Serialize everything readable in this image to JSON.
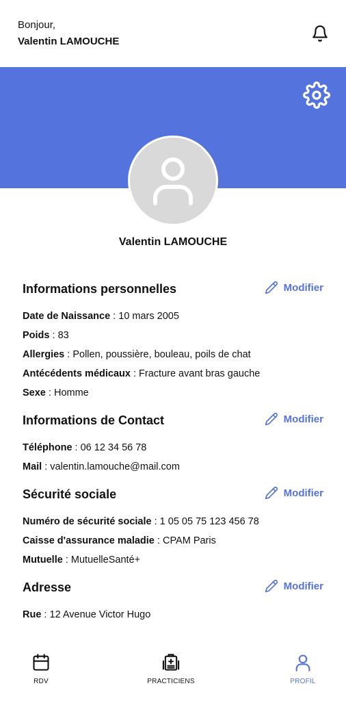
{
  "colors": {
    "accent": "#5573dc",
    "avatar_bg": "#d9d9d9",
    "text": "#111111"
  },
  "header": {
    "greeting": "Bonjour,",
    "user_name": "Valentin LAMOUCHE"
  },
  "profile": {
    "name": "Valentin LAMOUCHE"
  },
  "icons": {
    "bell": "bell-icon",
    "settings": "gear-icon",
    "edit": "pencil-icon",
    "avatar": "user-icon"
  },
  "sections": [
    {
      "title": "Informations personnelles",
      "action": "Modifier",
      "fields": [
        {
          "label": "Date de Naissance",
          "value": "10 mars 2005"
        },
        {
          "label": "Poids",
          "value": "83"
        },
        {
          "label": "Allergies",
          "value": "Pollen, poussière, bouleau, poils de chat"
        },
        {
          "label": "Antécédents médicaux",
          "value": "Fracture avant bras gauche"
        },
        {
          "label": "Sexe",
          "value": "Homme"
        }
      ]
    },
    {
      "title": "Informations de Contact",
      "action": "Modifier",
      "fields": [
        {
          "label": "Téléphone",
          "value": "06 12 34 56 78"
        },
        {
          "label": "Mail",
          "value": "valentin.lamouche@mail.com"
        }
      ]
    },
    {
      "title": "Sécurité sociale",
      "action": "Modifier",
      "fields": [
        {
          "label": "Numéro de sécurité sociale",
          "value": "1 05 05 75 123 456 78"
        },
        {
          "label": "Caisse d'assurance maladie",
          "value": "CPAM Paris"
        },
        {
          "label": "Mutuelle",
          "value": "MutuelleSanté+"
        }
      ]
    },
    {
      "title": "Adresse",
      "action": "Modifier",
      "fields": [
        {
          "label": "Rue",
          "value": "12 Avenue Victor Hugo"
        }
      ]
    }
  ],
  "nav": {
    "items": [
      {
        "label": "RDV",
        "icon": "calendar-icon",
        "active": false
      },
      {
        "label": "PRACTICIENS",
        "icon": "medical-folder-icon",
        "active": false
      },
      {
        "label": "PROFIL",
        "icon": "user-icon",
        "active": true
      }
    ]
  }
}
